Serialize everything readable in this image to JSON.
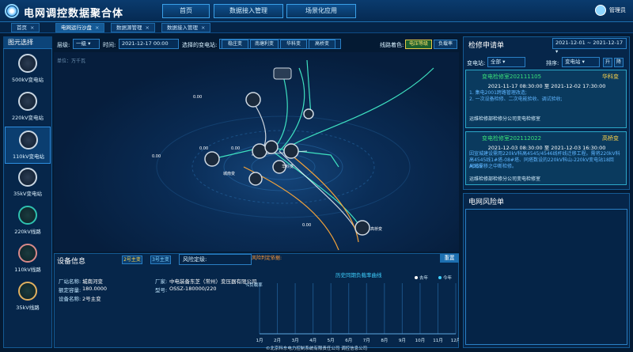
{
  "header": {
    "title": "电网调控数据聚合体",
    "nav": [
      "首页",
      "数据接入管理",
      "场景化应用"
    ],
    "user": "管理员"
  },
  "tabs": [
    {
      "label": "首页",
      "active": false
    },
    {
      "label": "电网运行沙盘",
      "active": true
    },
    {
      "label": "数据源管理",
      "active": false
    },
    {
      "label": "数据接入管理",
      "active": false
    }
  ],
  "sidebar": {
    "title": "图元选择",
    "items": [
      {
        "label": "500kV变电站",
        "kind": "station"
      },
      {
        "label": "220kV变电站",
        "kind": "station"
      },
      {
        "label": "110kV变电站",
        "kind": "station",
        "selected": true
      },
      {
        "label": "35kV变电站",
        "kind": "station"
      },
      {
        "label": "220kV线路",
        "kind": "line"
      },
      {
        "label": "110kV线路",
        "kind": "line-red"
      },
      {
        "label": "35kV线路",
        "kind": "line-gold"
      }
    ]
  },
  "filters": {
    "level_label": "层级:",
    "level_value": "一级",
    "time_label": "时间:",
    "time_value": "2021-12-17 00:00",
    "station_label": "选择的变电站:",
    "stations": [
      "稳庄变",
      "南塘利变",
      "华科变",
      "高桥变"
    ],
    "color_label": "线路着色:",
    "color_options": [
      "电压等级",
      "负载率"
    ],
    "color_active": "电压等级",
    "unit": "单位：万千瓦"
  },
  "map": {
    "node_value": "0.00",
    "labels": [
      "华科变",
      "城南变",
      "稳庄变",
      "南塘利变",
      "高桥变",
      "东城变"
    ]
  },
  "right": {
    "title": "检修申请单",
    "date_from": "2021-12-01",
    "date_to": "2021-12-17",
    "station_label": "变电站:",
    "station_value": "全部",
    "sort_label": "排序:",
    "sort_value": "变电站",
    "sort_toggle": [
      "升",
      "降"
    ],
    "cards": [
      {
        "title": "变电检修室202111105",
        "station": "华科变",
        "time": "2021-11-17 08:30:00 至 2021-12-02 17:30:00",
        "desc": [
          "1. 集电2001跨路管理改造;",
          "2. 一次设备检修、二次电能验收、调试验收;"
        ],
        "foot": "运维检修部检修分公司变电检修室"
      },
      {
        "title": "变电检修室202112022",
        "station": "高桥变",
        "time": "2021-12-03 08:30:00 至 2021-12-03 16:30:00",
        "desc": [
          "因宣城建设需用220kV科高4545/4546线杆线迁移工程。需将220kV科",
          "高4545线1#塔-08#塔、同塔数设的220kV科山-220kV变电站18回ADSS",
          "光缆需移之中断检修。"
        ],
        "foot": "运维检修部检修分公司变电检修室"
      }
    ]
  },
  "risk": {
    "title": "电网风险单"
  },
  "device": {
    "title": "设备信息",
    "chips": [
      "2号主变",
      "3号主变"
    ],
    "risk_label": "风险定级:",
    "risk_basis": "风险判定依据:",
    "close": "重置",
    "fields_left": [
      {
        "k": "厂站名称:",
        "v": "城南河变"
      },
      {
        "k": "额定容量:",
        "v": "180.0000"
      },
      {
        "k": "设备名称:",
        "v": "2号主变"
      }
    ],
    "fields_right": [
      {
        "k": "厂家:",
        "v": "中电装备东芝（常州）变压器有限公司"
      },
      {
        "k": "型号:",
        "v": "OSSZ-180000/220"
      }
    ]
  },
  "chart_data": {
    "type": "line",
    "title": "历史同期负载率曲线",
    "categories": [
      "1月",
      "2月",
      "3月",
      "4月",
      "5月",
      "6月",
      "7月",
      "8月",
      "9月",
      "10月",
      "11月",
      "12月"
    ],
    "series": [
      {
        "name": "去年",
        "color": "#ffffff",
        "values": []
      },
      {
        "name": "今年",
        "color": "#3fd0ff",
        "values": []
      }
    ],
    "ylabel": "%负载率",
    "grid": true,
    "legend": "top-right"
  },
  "footer": "©北京科东电力控制系统有限责任公司    调控信息公司"
}
